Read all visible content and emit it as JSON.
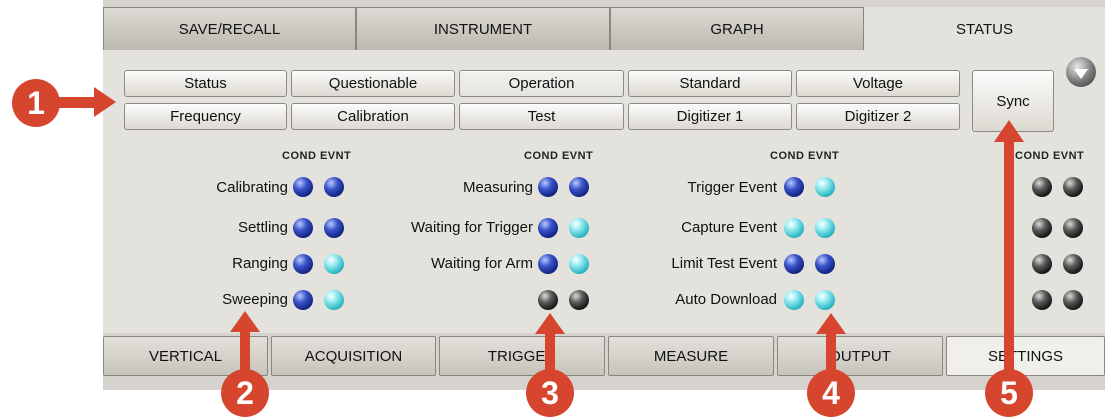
{
  "top_tabs": [
    "SAVE/RECALL",
    "INSTRUMENT",
    "GRAPH",
    "STATUS"
  ],
  "register_buttons": {
    "row1": [
      "Status",
      "Questionable",
      "Operation",
      "Standard",
      "Voltage"
    ],
    "row2": [
      "Frequency",
      "Calibration",
      "Test",
      "Digitizer 1",
      "Digitizer 2"
    ],
    "selected": "Operation"
  },
  "sync_label": "Sync",
  "column_header": "COND EVNT",
  "groups": [
    {
      "rows": [
        {
          "label": "Calibrating",
          "cond": "blue",
          "evnt": "blue"
        },
        {
          "label": "Settling",
          "cond": "blue",
          "evnt": "blue"
        },
        {
          "label": "Ranging",
          "cond": "blue",
          "evnt": "cyan"
        },
        {
          "label": "Sweeping",
          "cond": "blue",
          "evnt": "cyan"
        }
      ]
    },
    {
      "rows": [
        {
          "label": "Measuring",
          "cond": "blue",
          "evnt": "blue"
        },
        {
          "label": "Waiting for Trigger",
          "cond": "blue",
          "evnt": "cyan"
        },
        {
          "label": "Waiting for Arm",
          "cond": "blue",
          "evnt": "cyan"
        },
        {
          "label": "",
          "cond": "black",
          "evnt": "black"
        }
      ]
    },
    {
      "rows": [
        {
          "label": "Trigger Event",
          "cond": "blue",
          "evnt": "cyan"
        },
        {
          "label": "Capture Event",
          "cond": "cyan",
          "evnt": "cyan"
        },
        {
          "label": "Limit Test Event",
          "cond": "blue",
          "evnt": "blue"
        },
        {
          "label": "Auto Download",
          "cond": "cyan",
          "evnt": "cyan"
        }
      ]
    },
    {
      "rows": [
        {
          "label": "",
          "cond": "black",
          "evnt": "black"
        },
        {
          "label": "",
          "cond": "black",
          "evnt": "black"
        },
        {
          "label": "",
          "cond": "black",
          "evnt": "black"
        },
        {
          "label": "",
          "cond": "black",
          "evnt": "black"
        }
      ]
    }
  ],
  "bottom_tabs": [
    "VERTICAL",
    "ACQUISITION",
    "TRIGGER",
    "MEASURE",
    "OUTPUT",
    "SETTINGS"
  ],
  "callouts": [
    "1",
    "2",
    "3",
    "4",
    "5"
  ],
  "colors": {
    "callout": "#d6452e",
    "led_blue": "#1c30a0",
    "led_cyan": "#5fd4dc",
    "led_black": "#222222"
  }
}
